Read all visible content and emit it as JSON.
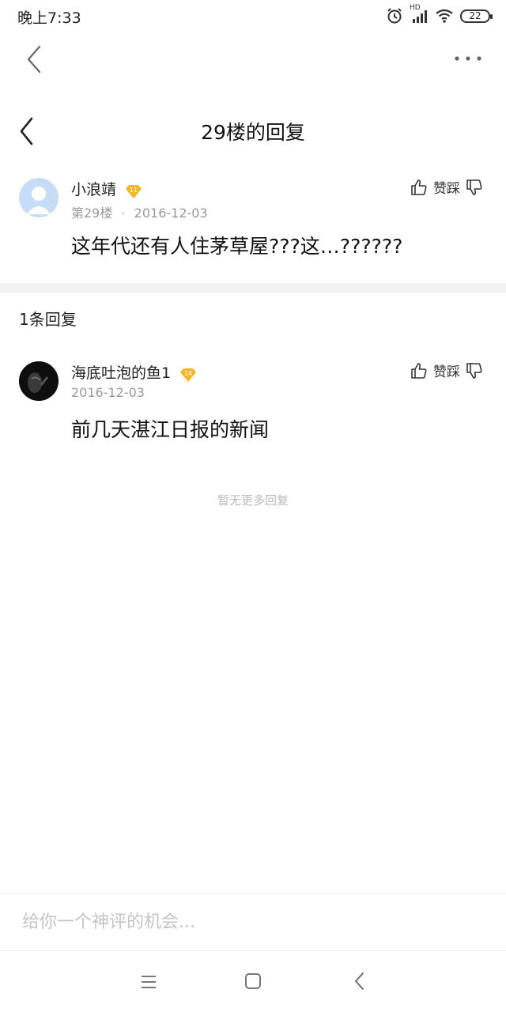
{
  "status_bar": {
    "time": "晚上7:33",
    "network": "HD",
    "battery": "22",
    "icons": [
      "alarm-icon",
      "signal-icon",
      "wifi-icon",
      "battery-icon"
    ]
  },
  "browser": {
    "icons": [
      "back-arrow-icon",
      "more-dots-icon"
    ]
  },
  "header": {
    "title": "29楼的回复",
    "back_icon": "chevron-left-icon"
  },
  "original_post": {
    "username": "小浪靖",
    "level": "11",
    "floor": "第29楼",
    "separator": "·",
    "date": "2016-12-03",
    "content": "这年代还有人住茅草屋???这…??????",
    "like_label": "赞",
    "dislike_label": "踩",
    "avatar_color": "#c7dcf7"
  },
  "replies_section": {
    "count_label": "1条回复",
    "replies": [
      {
        "username": "海底吐泡的鱼1",
        "level": "14",
        "date": "2016-12-03",
        "content": "前几天湛江日报的新闻",
        "like_label": "赞",
        "dislike_label": "踩"
      }
    ],
    "no_more": "暂无更多回复"
  },
  "comment_box": {
    "placeholder": "给你一个神评的机会..."
  },
  "colors": {
    "badge_gold": "#f3b72e",
    "divider": "#f2f2f2",
    "meta_gray": "#999999"
  },
  "nav_bar": {
    "icons": [
      "menu-icon",
      "home-square-icon",
      "back-triangle-icon"
    ]
  }
}
